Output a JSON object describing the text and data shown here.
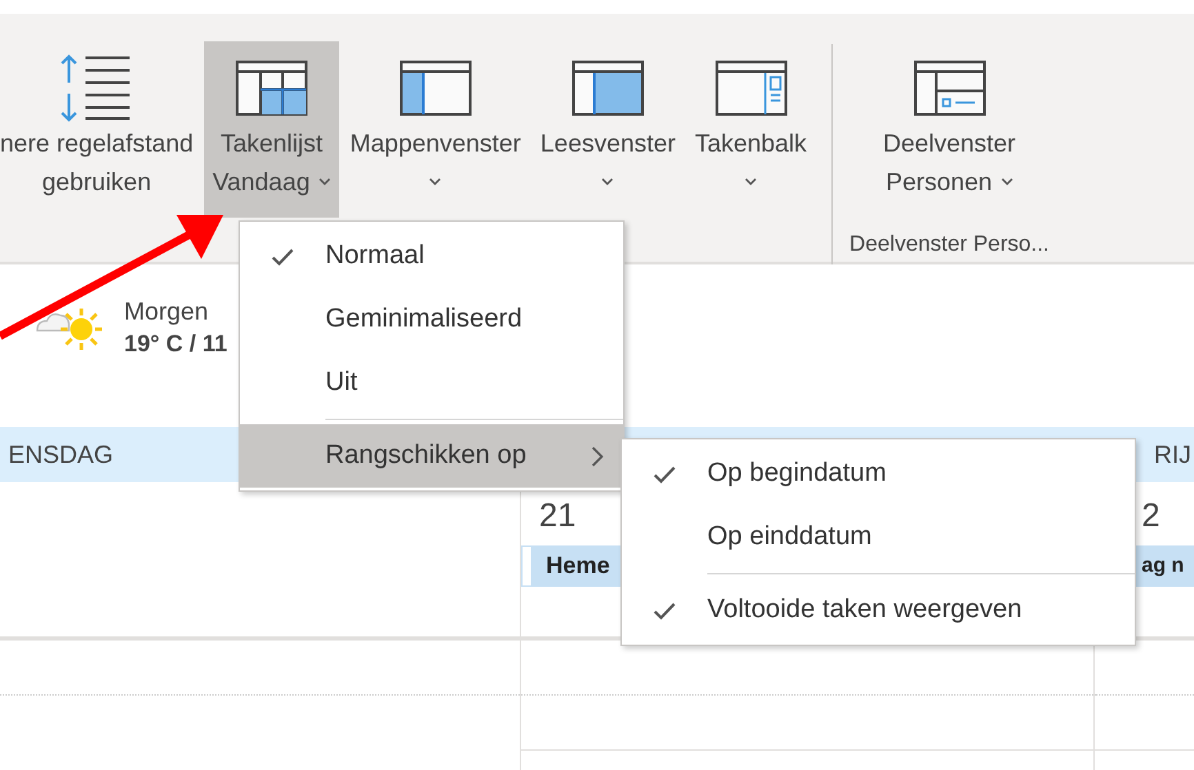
{
  "ribbon": {
    "groups": [
      {
        "buttons": [
          {
            "kind": "line-spacing",
            "label_lines": [
              "nere regelafstand",
              "gebruiken"
            ],
            "dropdown": false,
            "selected": false
          },
          {
            "kind": "task-list",
            "label_lines": [
              "Takenlijst",
              "Vandaag"
            ],
            "dropdown": true,
            "selected": true
          },
          {
            "kind": "folder-pane",
            "label_lines": [
              "Mappenvenster"
            ],
            "dropdown": true,
            "selected": false
          },
          {
            "kind": "reading-pane",
            "label_lines": [
              "Leesvenster"
            ],
            "dropdown": true,
            "selected": false
          },
          {
            "kind": "task-bar",
            "label_lines": [
              "Takenbalk"
            ],
            "dropdown": true,
            "selected": false
          }
        ]
      },
      {
        "label": "Deelvenster Perso...",
        "buttons": [
          {
            "kind": "people-pane",
            "label_lines": [
              "Deelvenster",
              "Personen"
            ],
            "dropdown": true,
            "selected": false
          }
        ]
      }
    ]
  },
  "weather": {
    "day": "Morgen",
    "temperature": "19° C / 11"
  },
  "day_headers": [
    "ENSDAG",
    "RIJ"
  ],
  "dates": [
    "21",
    "2"
  ],
  "events": [
    "Heme",
    "ag n"
  ],
  "menu": [
    {
      "kind": "item",
      "label": "Normaal",
      "checked": true,
      "selected": false,
      "submenu": false
    },
    {
      "kind": "item",
      "label": "Geminimaliseerd",
      "checked": false,
      "selected": false,
      "submenu": false
    },
    {
      "kind": "item",
      "label": "Uit",
      "checked": false,
      "selected": false,
      "submenu": false
    },
    {
      "kind": "separator"
    },
    {
      "kind": "item",
      "label": "Rangschikken op",
      "checked": false,
      "selected": true,
      "submenu": true
    }
  ],
  "submenu": [
    {
      "kind": "item",
      "label": "Op begindatum",
      "checked": true,
      "selected": false,
      "submenu": false
    },
    {
      "kind": "item",
      "label": "Op einddatum",
      "checked": false,
      "selected": false,
      "submenu": false
    },
    {
      "kind": "separator"
    },
    {
      "kind": "item",
      "label": "Voltooide taken weergeven",
      "checked": true,
      "selected": false,
      "submenu": false
    }
  ]
}
